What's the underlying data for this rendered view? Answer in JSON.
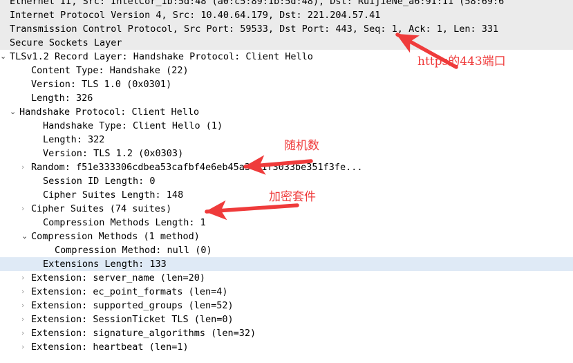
{
  "app": {
    "name": "Wireshark Packet Details Pane",
    "pane": "packet-detail-tree"
  },
  "colors": {
    "text": "#000000",
    "shaded_row_bg": "#ebebeb",
    "selected_row_bg": "#dfeaf6",
    "annotation_red": "#ef3b3b",
    "twisty_collapsed": "#9a9a9a",
    "twisty_expanded": "#3a3a3a",
    "background": "#ffffff"
  },
  "tree": {
    "rows": [
      {
        "id": "ethernet",
        "indent": 0,
        "twisty": "none",
        "shaded": true,
        "selected": false,
        "clipped": true,
        "text": "Ethernet II, Src: IntelCor_1b:5d:48 (a0:c5:89:1b:5d:48), Dst: RuijieNe_a6:91:11 (58:69:6"
      },
      {
        "id": "ipv4",
        "indent": 0,
        "twisty": "none",
        "shaded": true,
        "selected": false,
        "clipped": false,
        "text": "Internet Protocol Version 4, Src: 10.40.64.179, Dst: 221.204.57.41"
      },
      {
        "id": "tcp",
        "indent": 0,
        "twisty": "none",
        "shaded": true,
        "selected": false,
        "clipped": false,
        "text": "Transmission Control Protocol, Src Port: 59533, Dst Port: 443, Seq: 1, Ack: 1, Len: 331"
      },
      {
        "id": "ssl",
        "indent": 0,
        "twisty": "none",
        "shaded": true,
        "selected": false,
        "clipped": false,
        "text": "Secure Sockets Layer"
      },
      {
        "id": "tls-record-layer",
        "indent": 0,
        "twisty": "open",
        "shaded": false,
        "selected": false,
        "clipped": false,
        "text": "TLSv1.2 Record Layer: Handshake Protocol: Client Hello"
      },
      {
        "id": "content-type",
        "indent": 2,
        "twisty": "none",
        "shaded": false,
        "selected": false,
        "clipped": false,
        "text": "Content Type: Handshake (22)"
      },
      {
        "id": "version-record",
        "indent": 2,
        "twisty": "none",
        "shaded": false,
        "selected": false,
        "clipped": false,
        "text": "Version: TLS 1.0 (0x0301)"
      },
      {
        "id": "length-record",
        "indent": 2,
        "twisty": "none",
        "shaded": false,
        "selected": false,
        "clipped": false,
        "text": "Length: 326"
      },
      {
        "id": "handshake-protocol",
        "indent": 1,
        "twisty": "open",
        "shaded": false,
        "selected": false,
        "clipped": false,
        "text": "Handshake Protocol: Client Hello"
      },
      {
        "id": "handshake-type",
        "indent": 3,
        "twisty": "none",
        "shaded": false,
        "selected": false,
        "clipped": false,
        "text": "Handshake Type: Client Hello (1)"
      },
      {
        "id": "handshake-length",
        "indent": 3,
        "twisty": "none",
        "shaded": false,
        "selected": false,
        "clipped": false,
        "text": "Length: 322"
      },
      {
        "id": "handshake-version",
        "indent": 3,
        "twisty": "none",
        "shaded": false,
        "selected": false,
        "clipped": false,
        "text": "Version: TLS 1.2 (0x0303)"
      },
      {
        "id": "random",
        "indent": 2,
        "twisty": "closed",
        "shaded": false,
        "selected": false,
        "clipped": false,
        "text": "Random: f51e333306cdbea53cafbf4e6eb45a3431f3033be351f3fe..."
      },
      {
        "id": "session-id-length",
        "indent": 3,
        "twisty": "none",
        "shaded": false,
        "selected": false,
        "clipped": false,
        "text": "Session ID Length: 0"
      },
      {
        "id": "cipher-suites-length",
        "indent": 3,
        "twisty": "none",
        "shaded": false,
        "selected": false,
        "clipped": false,
        "text": "Cipher Suites Length: 148"
      },
      {
        "id": "cipher-suites",
        "indent": 2,
        "twisty": "closed",
        "shaded": false,
        "selected": false,
        "clipped": false,
        "text": "Cipher Suites (74 suites)"
      },
      {
        "id": "compression-methods-length",
        "indent": 3,
        "twisty": "none",
        "shaded": false,
        "selected": false,
        "clipped": false,
        "text": "Compression Methods Length: 1"
      },
      {
        "id": "compression-methods",
        "indent": 2,
        "twisty": "open",
        "shaded": false,
        "selected": false,
        "clipped": false,
        "text": "Compression Methods (1 method)"
      },
      {
        "id": "compression-method",
        "indent": 4,
        "twisty": "none",
        "shaded": false,
        "selected": false,
        "clipped": false,
        "text": "Compression Method: null (0)"
      },
      {
        "id": "extensions-length",
        "indent": 3,
        "twisty": "none",
        "shaded": false,
        "selected": true,
        "clipped": false,
        "text": "Extensions Length: 133"
      },
      {
        "id": "extension-server-name",
        "indent": 2,
        "twisty": "closed",
        "shaded": false,
        "selected": false,
        "clipped": false,
        "text": "Extension: server_name (len=20)"
      },
      {
        "id": "extension-ec-point-formats",
        "indent": 2,
        "twisty": "closed",
        "shaded": false,
        "selected": false,
        "clipped": false,
        "text": "Extension: ec_point_formats (len=4)"
      },
      {
        "id": "extension-supported-groups",
        "indent": 2,
        "twisty": "closed",
        "shaded": false,
        "selected": false,
        "clipped": false,
        "text": "Extension: supported_groups (len=52)"
      },
      {
        "id": "extension-sessionticket-tls",
        "indent": 2,
        "twisty": "closed",
        "shaded": false,
        "selected": false,
        "clipped": false,
        "text": "Extension: SessionTicket TLS (len=0)"
      },
      {
        "id": "extension-signature-algorithms",
        "indent": 2,
        "twisty": "closed",
        "shaded": false,
        "selected": false,
        "clipped": false,
        "text": "Extension: signature_algorithms (len=32)"
      },
      {
        "id": "extension-heartbeat",
        "indent": 2,
        "twisty": "closed",
        "shaded": false,
        "selected": false,
        "clipped": false,
        "text": "Extension: heartbeat (len=1)"
      }
    ]
  },
  "annotations": [
    {
      "id": "port-443",
      "text": "https的443端口",
      "target": "Dst Port: 443"
    },
    {
      "id": "random",
      "text": "随机数",
      "target": "Random"
    },
    {
      "id": "cipher-suites",
      "text": "加密套件",
      "target": "Cipher Suites (74 suites)"
    }
  ],
  "glyphs": {
    "twisty_open": "⌄",
    "twisty_closed": "›"
  }
}
